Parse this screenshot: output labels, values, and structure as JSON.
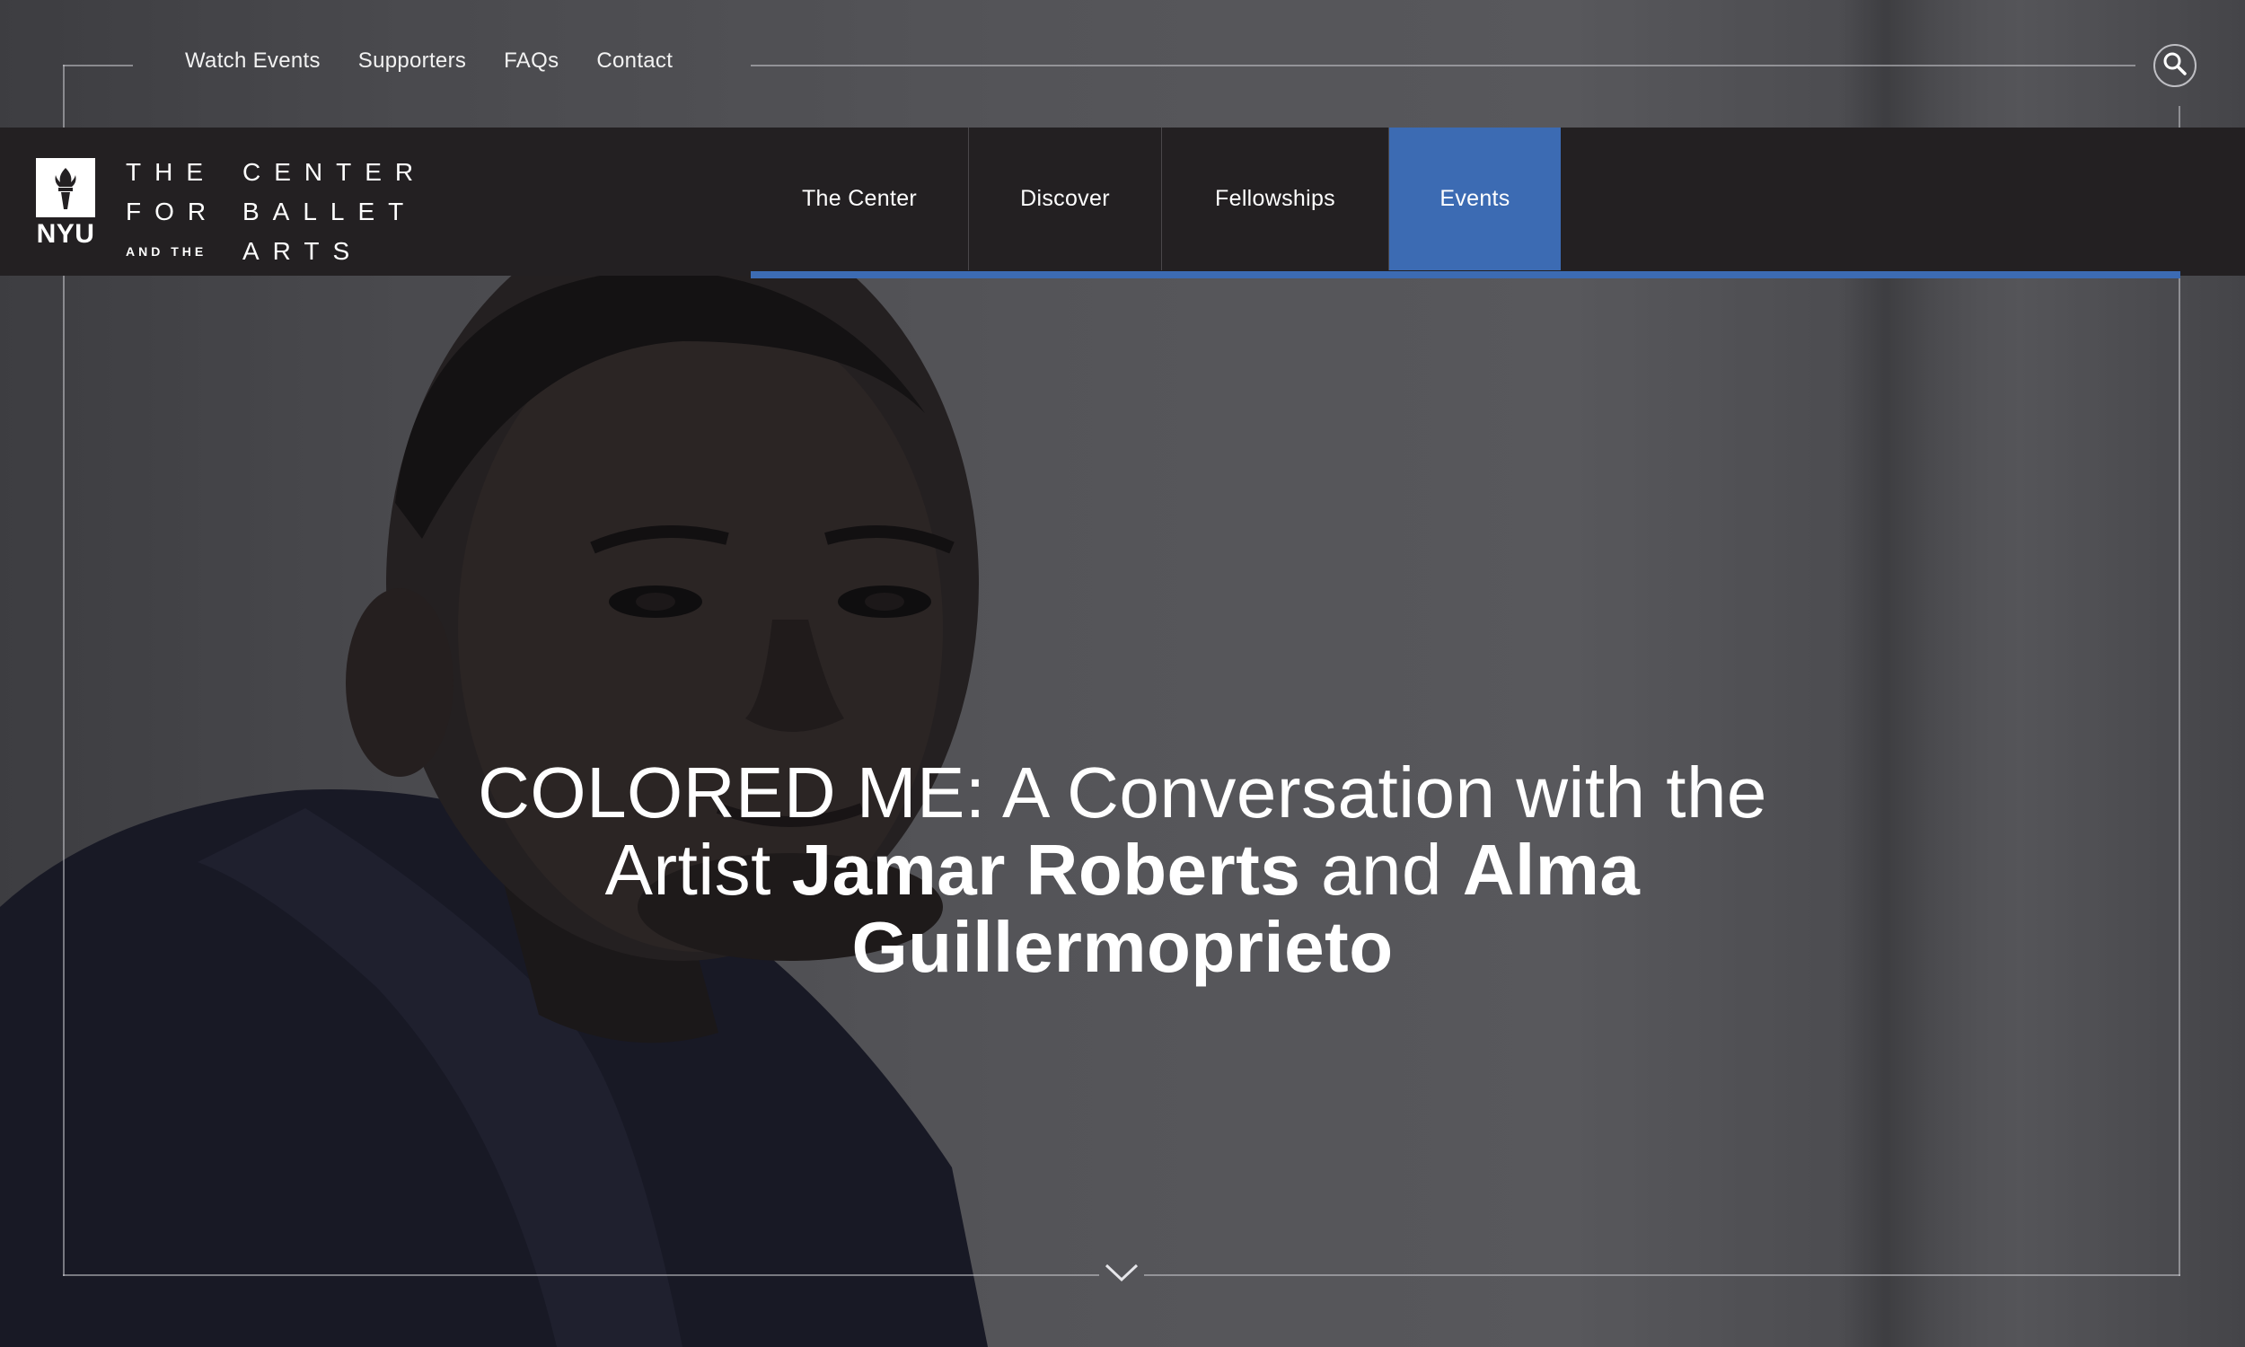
{
  "utility_nav": {
    "items": [
      {
        "label": "Watch Events"
      },
      {
        "label": "Supporters"
      },
      {
        "label": "FAQs"
      },
      {
        "label": "Contact"
      }
    ],
    "search_icon": "search-icon"
  },
  "logo": {
    "nyu": "NYU",
    "line1_left": "THE",
    "line1_right": "CENTER",
    "line2_left": "FOR",
    "line2_right": "BALLET",
    "line3_left": "AND THE",
    "line3_right": "ARTS"
  },
  "main_nav": {
    "items": [
      {
        "label": "The Center",
        "active": false
      },
      {
        "label": "Discover",
        "active": false
      },
      {
        "label": "Fellowships",
        "active": false
      },
      {
        "label": "Events",
        "active": true
      }
    ]
  },
  "hero": {
    "title_part1": "COLORED ME: A Conversation with the Artist ",
    "title_bold1": "Jamar Roberts",
    "title_part2": " and ",
    "title_bold2": "Alma Guillermoprieto",
    "scroll_icon": "chevron-down-icon"
  },
  "colors": {
    "header_bg": "#232022",
    "accent": "#3c6bb3",
    "text": "#ffffff"
  }
}
